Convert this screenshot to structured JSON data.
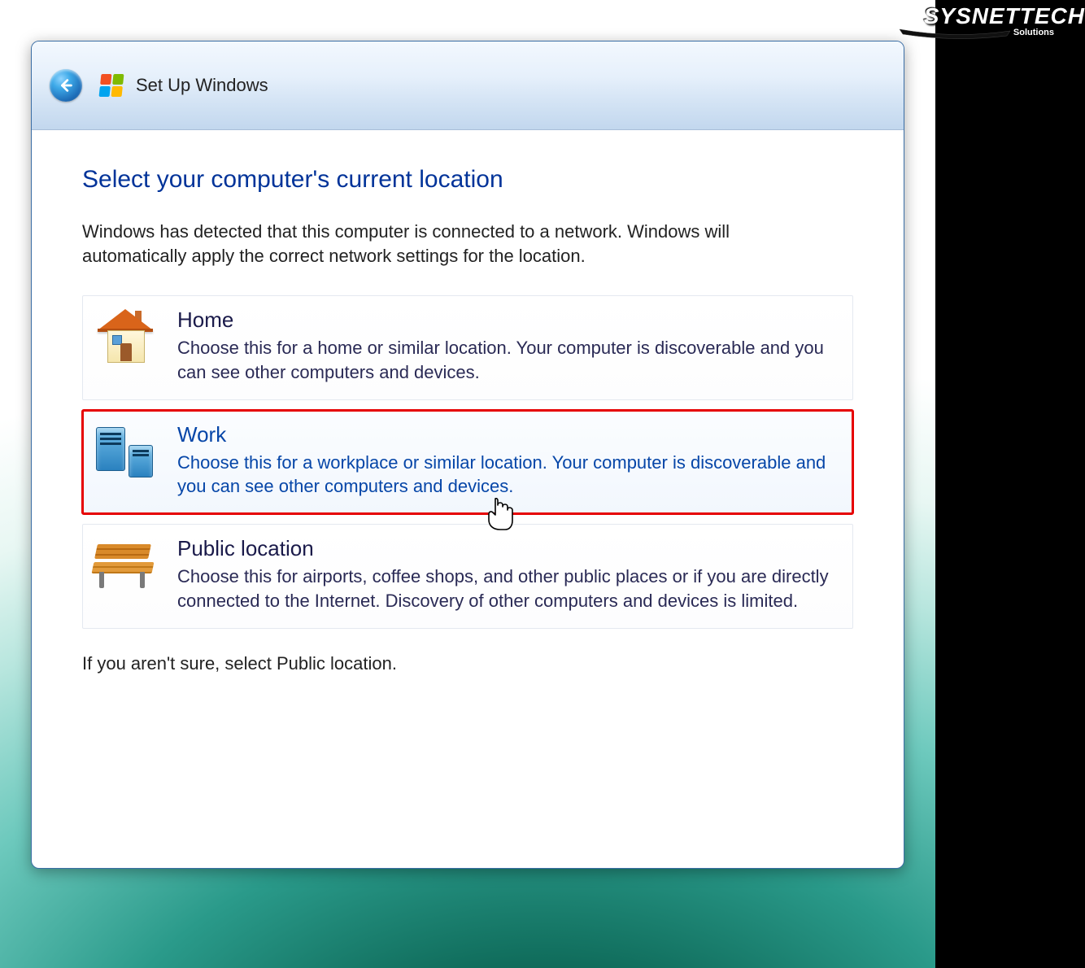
{
  "watermark": {
    "brand": "SYSNETTECH",
    "sub": "Solutions"
  },
  "titlebar": {
    "title": "Set Up Windows"
  },
  "page": {
    "heading": "Select your computer's current location",
    "intro": "Windows has detected that this computer is connected to a network. Windows will automatically apply the correct network settings for the location.",
    "footer": "If you aren't sure, select Public location."
  },
  "options": {
    "home": {
      "title": "Home",
      "desc": "Choose this for a home or similar location. Your computer is discoverable and you can see other computers and devices."
    },
    "work": {
      "title": "Work",
      "desc": "Choose this for a workplace or similar location. Your computer is discoverable and you can see other computers and devices."
    },
    "public": {
      "title": "Public location",
      "desc": "Choose this for airports, coffee shops, and other public places or if you are directly connected to the Internet. Discovery of other computers and devices is limited."
    }
  }
}
